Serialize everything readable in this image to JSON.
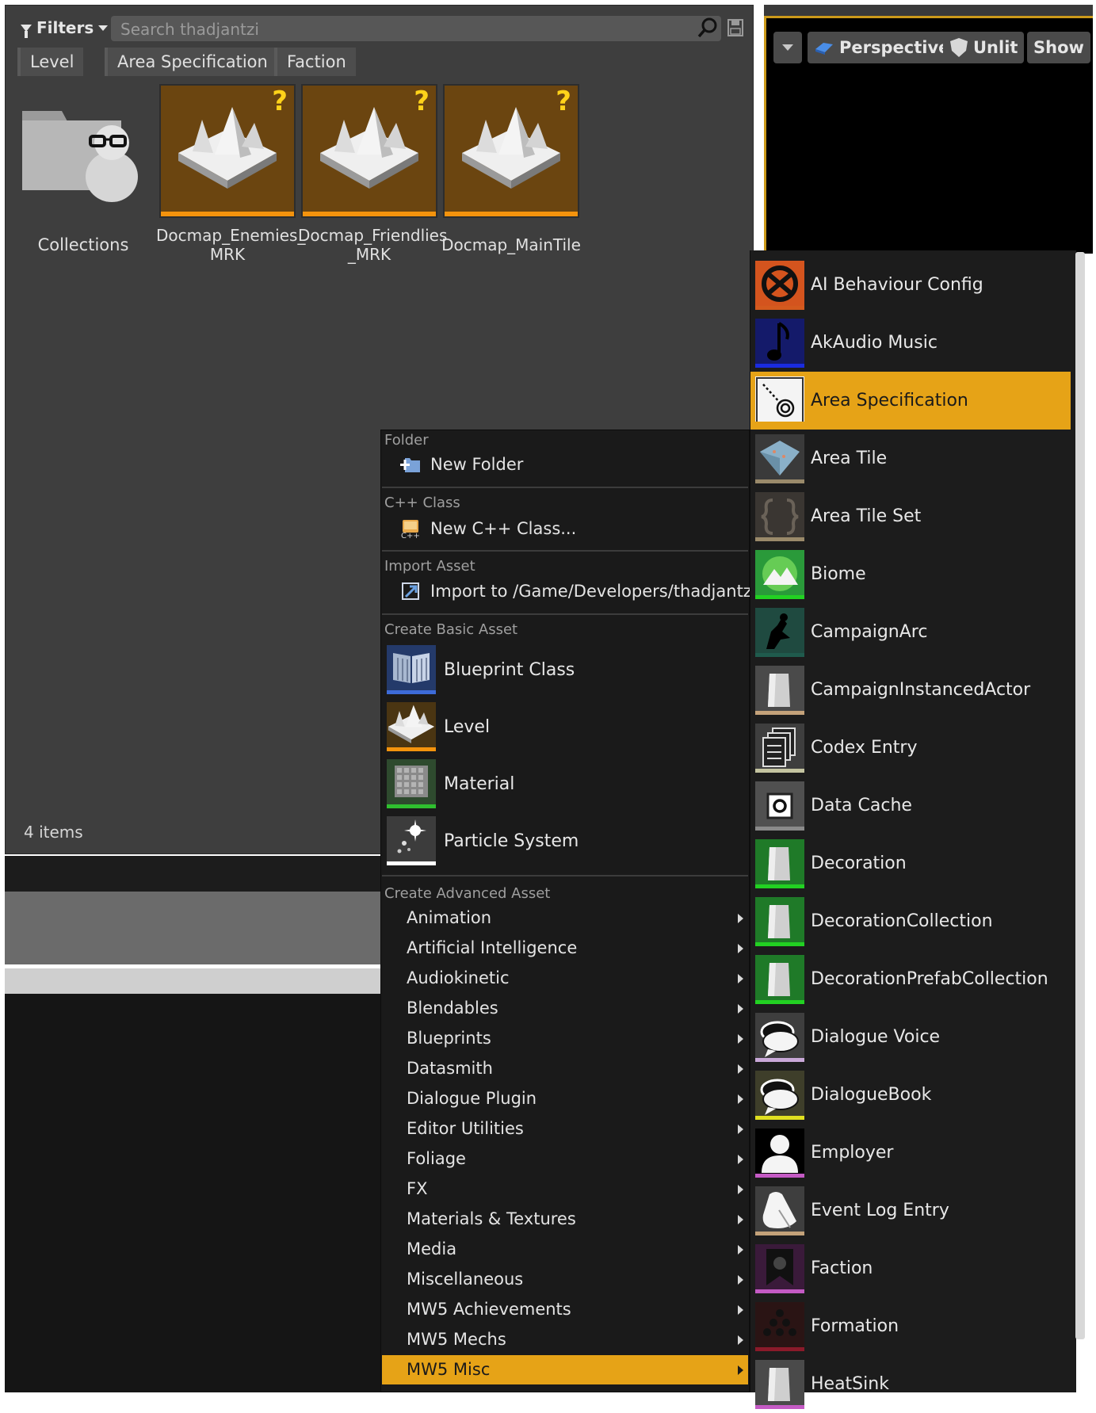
{
  "toolbar": {
    "filters_label": "Filters",
    "search_placeholder": "Search thadjantzi",
    "filter_chips": [
      "Level",
      "Area Specification",
      "Faction"
    ]
  },
  "assets": {
    "collections_label": "Collections",
    "tiles": [
      {
        "label_line1": "Docmap_Enemies_",
        "label_line2": "MRK"
      },
      {
        "label_line1": "Docmap_Friendlies",
        "label_line2": "_MRK"
      },
      {
        "label_line1": "Docmap_MainTile",
        "label_line2": ""
      }
    ],
    "unknown_marker": "?",
    "items_count": "4 items"
  },
  "viewport": {
    "buttons": [
      "Perspective",
      "Unlit",
      "Show"
    ]
  },
  "context_menu": {
    "sections": {
      "folder": "Folder",
      "cpp": "C++ Class",
      "import": "Import Asset",
      "basic": "Create Basic Asset",
      "advanced": "Create Advanced Asset"
    },
    "new_folder": "New Folder",
    "new_cpp": "New C++ Class...",
    "import_to": "Import to /Game/Developers/thadjantzi...",
    "basic_items": [
      {
        "label": "Blueprint Class",
        "icon": "blueprint-icon",
        "stripe": "#3d6bd8"
      },
      {
        "label": "Level",
        "icon": "level-icon",
        "stripe": "#f4930d"
      },
      {
        "label": "Material",
        "icon": "material-icon",
        "stripe": "#2fbf2f"
      },
      {
        "label": "Particle System",
        "icon": "particle-icon",
        "stripe": "#ffffff"
      }
    ],
    "advanced_items": [
      "Animation",
      "Artificial Intelligence",
      "Audiokinetic",
      "Blendables",
      "Blueprints",
      "Datasmith",
      "Dialogue Plugin",
      "Editor Utilities",
      "Foliage",
      "FX",
      "Materials & Textures",
      "Media",
      "Miscellaneous",
      "MW5 Achievements",
      "MW5 Mechs",
      "MW5 Misc"
    ],
    "selected_advanced": "MW5 Misc"
  },
  "submenu": {
    "items": [
      {
        "label": "AI Behaviour Config",
        "icon": "ai-behaviour-icon",
        "stripe": "#d45a1e"
      },
      {
        "label": "AkAudio Music",
        "icon": "music-note-icon",
        "stripe": "#1a2be0"
      },
      {
        "label": "Area Specification",
        "icon": "area-spec-icon",
        "stripe": "#e6a317"
      },
      {
        "label": "Area Tile",
        "icon": "area-tile-icon",
        "stripe": "#9a8a6a"
      },
      {
        "label": "Area Tile Set",
        "icon": "area-tile-set-icon",
        "stripe": "#9a8a6a"
      },
      {
        "label": "Biome",
        "icon": "biome-icon",
        "stripe": "#22d122"
      },
      {
        "label": "CampaignArc",
        "icon": "campaign-arc-icon",
        "stripe": "#1f5b4d"
      },
      {
        "label": "CampaignInstancedActor",
        "icon": "actor-icon",
        "stripe": "#c4a27a"
      },
      {
        "label": "Codex Entry",
        "icon": "codex-icon",
        "stripe": "#c4c4a0"
      },
      {
        "label": "Data Cache",
        "icon": "data-cache-icon",
        "stripe": "#8a8a8a"
      },
      {
        "label": "Decoration",
        "icon": "decoration-icon",
        "stripe": "#22d122"
      },
      {
        "label": "DecorationCollection",
        "icon": "decoration-collection-icon",
        "stripe": "#22d122"
      },
      {
        "label": "DecorationPrefabCollection",
        "icon": "decoration-prefab-icon",
        "stripe": "#22d122"
      },
      {
        "label": "Dialogue Voice",
        "icon": "dialogue-voice-icon",
        "stripe": "#c9a8d8"
      },
      {
        "label": "DialogueBook",
        "icon": "dialogue-book-icon",
        "stripe": "#e0e020"
      },
      {
        "label": "Employer",
        "icon": "employer-icon",
        "stripe": "#c45ac4"
      },
      {
        "label": "Event Log Entry",
        "icon": "event-log-icon",
        "stripe": "#c4a27a"
      },
      {
        "label": "Faction",
        "icon": "faction-icon",
        "stripe": "#c45ac4"
      },
      {
        "label": "Formation",
        "icon": "formation-icon",
        "stripe": "#8a1a2a"
      },
      {
        "label": "HeatSink",
        "icon": "heatsink-icon",
        "stripe": "#c45ac4"
      }
    ],
    "selected": "Area Specification"
  }
}
